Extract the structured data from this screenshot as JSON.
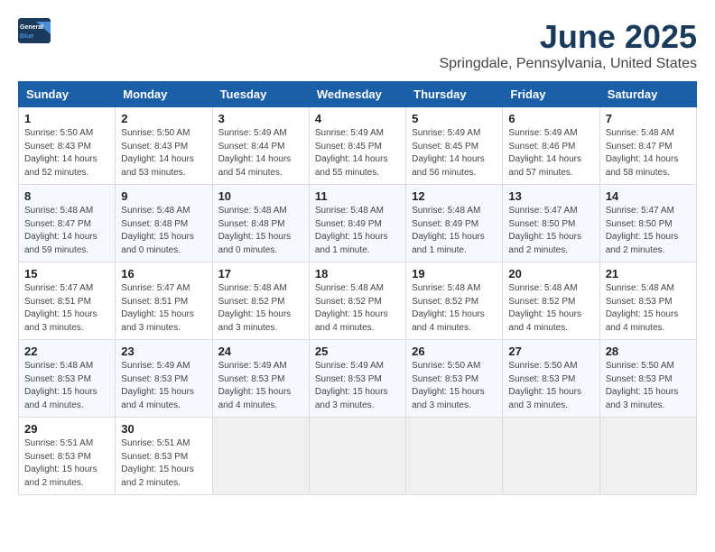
{
  "header": {
    "logo_line1": "General",
    "logo_line2": "Blue",
    "month": "June 2025",
    "location": "Springdale, Pennsylvania, United States"
  },
  "days_of_week": [
    "Sunday",
    "Monday",
    "Tuesday",
    "Wednesday",
    "Thursday",
    "Friday",
    "Saturday"
  ],
  "weeks": [
    [
      {
        "day": "1",
        "info": "Sunrise: 5:50 AM\nSunset: 8:43 PM\nDaylight: 14 hours\nand 52 minutes."
      },
      {
        "day": "2",
        "info": "Sunrise: 5:50 AM\nSunset: 8:43 PM\nDaylight: 14 hours\nand 53 minutes."
      },
      {
        "day": "3",
        "info": "Sunrise: 5:49 AM\nSunset: 8:44 PM\nDaylight: 14 hours\nand 54 minutes."
      },
      {
        "day": "4",
        "info": "Sunrise: 5:49 AM\nSunset: 8:45 PM\nDaylight: 14 hours\nand 55 minutes."
      },
      {
        "day": "5",
        "info": "Sunrise: 5:49 AM\nSunset: 8:45 PM\nDaylight: 14 hours\nand 56 minutes."
      },
      {
        "day": "6",
        "info": "Sunrise: 5:49 AM\nSunset: 8:46 PM\nDaylight: 14 hours\nand 57 minutes."
      },
      {
        "day": "7",
        "info": "Sunrise: 5:48 AM\nSunset: 8:47 PM\nDaylight: 14 hours\nand 58 minutes."
      }
    ],
    [
      {
        "day": "8",
        "info": "Sunrise: 5:48 AM\nSunset: 8:47 PM\nDaylight: 14 hours\nand 59 minutes."
      },
      {
        "day": "9",
        "info": "Sunrise: 5:48 AM\nSunset: 8:48 PM\nDaylight: 15 hours\nand 0 minutes."
      },
      {
        "day": "10",
        "info": "Sunrise: 5:48 AM\nSunset: 8:48 PM\nDaylight: 15 hours\nand 0 minutes."
      },
      {
        "day": "11",
        "info": "Sunrise: 5:48 AM\nSunset: 8:49 PM\nDaylight: 15 hours\nand 1 minute."
      },
      {
        "day": "12",
        "info": "Sunrise: 5:48 AM\nSunset: 8:49 PM\nDaylight: 15 hours\nand 1 minute."
      },
      {
        "day": "13",
        "info": "Sunrise: 5:47 AM\nSunset: 8:50 PM\nDaylight: 15 hours\nand 2 minutes."
      },
      {
        "day": "14",
        "info": "Sunrise: 5:47 AM\nSunset: 8:50 PM\nDaylight: 15 hours\nand 2 minutes."
      }
    ],
    [
      {
        "day": "15",
        "info": "Sunrise: 5:47 AM\nSunset: 8:51 PM\nDaylight: 15 hours\nand 3 minutes."
      },
      {
        "day": "16",
        "info": "Sunrise: 5:47 AM\nSunset: 8:51 PM\nDaylight: 15 hours\nand 3 minutes."
      },
      {
        "day": "17",
        "info": "Sunrise: 5:48 AM\nSunset: 8:52 PM\nDaylight: 15 hours\nand 3 minutes."
      },
      {
        "day": "18",
        "info": "Sunrise: 5:48 AM\nSunset: 8:52 PM\nDaylight: 15 hours\nand 4 minutes."
      },
      {
        "day": "19",
        "info": "Sunrise: 5:48 AM\nSunset: 8:52 PM\nDaylight: 15 hours\nand 4 minutes."
      },
      {
        "day": "20",
        "info": "Sunrise: 5:48 AM\nSunset: 8:52 PM\nDaylight: 15 hours\nand 4 minutes."
      },
      {
        "day": "21",
        "info": "Sunrise: 5:48 AM\nSunset: 8:53 PM\nDaylight: 15 hours\nand 4 minutes."
      }
    ],
    [
      {
        "day": "22",
        "info": "Sunrise: 5:48 AM\nSunset: 8:53 PM\nDaylight: 15 hours\nand 4 minutes."
      },
      {
        "day": "23",
        "info": "Sunrise: 5:49 AM\nSunset: 8:53 PM\nDaylight: 15 hours\nand 4 minutes."
      },
      {
        "day": "24",
        "info": "Sunrise: 5:49 AM\nSunset: 8:53 PM\nDaylight: 15 hours\nand 4 minutes."
      },
      {
        "day": "25",
        "info": "Sunrise: 5:49 AM\nSunset: 8:53 PM\nDaylight: 15 hours\nand 3 minutes."
      },
      {
        "day": "26",
        "info": "Sunrise: 5:50 AM\nSunset: 8:53 PM\nDaylight: 15 hours\nand 3 minutes."
      },
      {
        "day": "27",
        "info": "Sunrise: 5:50 AM\nSunset: 8:53 PM\nDaylight: 15 hours\nand 3 minutes."
      },
      {
        "day": "28",
        "info": "Sunrise: 5:50 AM\nSunset: 8:53 PM\nDaylight: 15 hours\nand 3 minutes."
      }
    ],
    [
      {
        "day": "29",
        "info": "Sunrise: 5:51 AM\nSunset: 8:53 PM\nDaylight: 15 hours\nand 2 minutes."
      },
      {
        "day": "30",
        "info": "Sunrise: 5:51 AM\nSunset: 8:53 PM\nDaylight: 15 hours\nand 2 minutes."
      },
      {
        "day": "",
        "info": ""
      },
      {
        "day": "",
        "info": ""
      },
      {
        "day": "",
        "info": ""
      },
      {
        "day": "",
        "info": ""
      },
      {
        "day": "",
        "info": ""
      }
    ]
  ]
}
